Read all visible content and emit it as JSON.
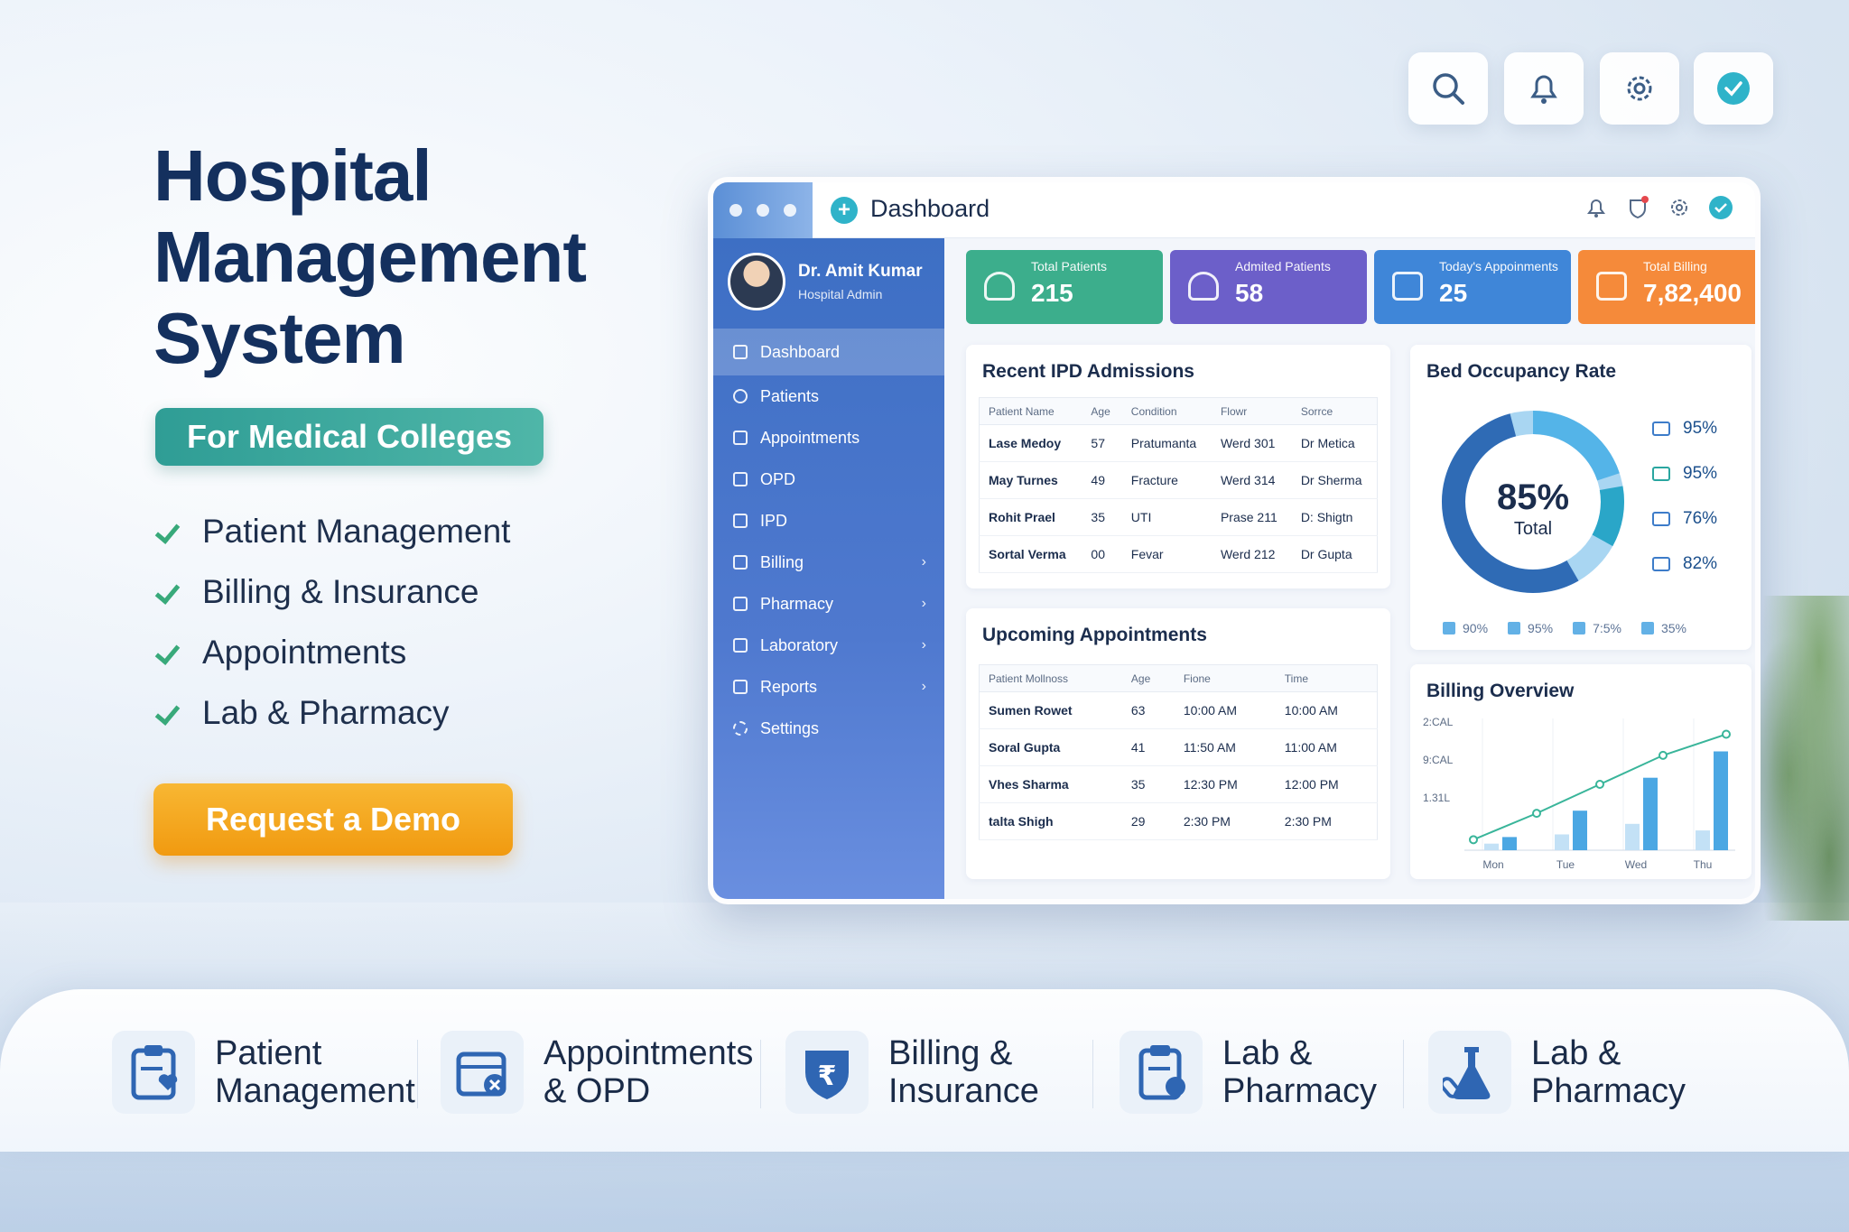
{
  "hero": {
    "title_lines": [
      "Hospital",
      "Management",
      "System"
    ],
    "badge": "For Medical Colleges",
    "features": [
      "Patient Management",
      "Billing & Insurance",
      "Appointments",
      "Lab & Pharmacy"
    ],
    "cta": "Request a Demo"
  },
  "top_icons": [
    "search-icon",
    "bell-icon",
    "gear-icon",
    "check-circle-icon"
  ],
  "window": {
    "title": "Dashboard",
    "header_icons": [
      "bell-icon",
      "shield-icon",
      "gear-icon",
      "check-circle-icon"
    ]
  },
  "sidebar": {
    "user_name": "Dr. Amit Kumar",
    "user_role": "Hospital Admin",
    "items": [
      {
        "label": "Dashboard",
        "icon": "dashboard-icon",
        "active": true
      },
      {
        "label": "Patients",
        "icon": "user-icon"
      },
      {
        "label": "Appointments",
        "icon": "calendar-icon"
      },
      {
        "label": "OPD",
        "icon": "opd-icon"
      },
      {
        "label": "IPD",
        "icon": "bed-icon"
      },
      {
        "label": "Billing",
        "icon": "billing-icon",
        "chevron": true
      },
      {
        "label": "Pharmacy",
        "icon": "pharmacy-icon",
        "chevron": true
      },
      {
        "label": "Laboratory",
        "icon": "lab-icon",
        "chevron": true
      },
      {
        "label": "Reports",
        "icon": "report-icon",
        "chevron": true
      },
      {
        "label": "Settings",
        "icon": "gear-icon"
      }
    ]
  },
  "stats": [
    {
      "label": "Total Patients",
      "value": "215",
      "color": "#3cae8c"
    },
    {
      "label": "Admited Patients",
      "value": "58",
      "color": "#6c5fc9"
    },
    {
      "label": "Today's Appoinments",
      "value": "25",
      "color": "#3f86d8"
    },
    {
      "label": "Total Billing",
      "value": "7,82,400",
      "color": "#f58a3a"
    }
  ],
  "ipd": {
    "title": "Recent IPD Admissions",
    "headers": [
      "Patient Name",
      "Age",
      "Condition",
      "Flowr",
      "Sorrce"
    ],
    "rows": [
      [
        "Lase Medoy",
        "57",
        "Pratumanta",
        "Werd 301",
        "Dr Metica"
      ],
      [
        "May Turnes",
        "49",
        "Fracture",
        "Werd 314",
        "Dr Sherma"
      ],
      [
        "Rohit Prael",
        "35",
        "UTI",
        "Prase 211",
        "D: Shigtn"
      ],
      [
        "Sortal Verma",
        "00",
        "Fevar",
        "Werd 212",
        "Dr Gupta"
      ]
    ]
  },
  "appointments": {
    "title": "Upcoming Appointments",
    "headers": [
      "Patient Mollnoss",
      "Age",
      "Fione",
      "Time"
    ],
    "rows": [
      [
        "Sumen Rowet",
        "63",
        "10:00 AM",
        "10:00 AM"
      ],
      [
        "Soral Gupta",
        "41",
        "11:50 AM",
        "11:00 AM"
      ],
      [
        "Vhes Sharma",
        "35",
        "12:30 PM",
        "12:00 PM"
      ],
      [
        "talta Shigh",
        "29",
        "2:30 PM",
        "2:30 PM"
      ]
    ]
  },
  "bed": {
    "title": "Bed Occupancy Rate",
    "center_value": "85%",
    "center_label": "Total",
    "side_values": [
      "95%",
      "95%",
      "76%",
      "82%"
    ],
    "bottom_values": [
      "90%",
      "95%",
      "7:5%",
      "35%"
    ],
    "colors": [
      "#2f6bb5",
      "#54b4e8",
      "#2aa6c8",
      "#a9d6f2"
    ]
  },
  "billing": {
    "title": "Billing Overview",
    "y_labels": [
      "2:CAL",
      "9:CAL",
      "1.31L"
    ],
    "x_labels": [
      "Mon",
      "Tue",
      "Wed",
      "Thu"
    ]
  },
  "chart_data": {
    "type": "bar",
    "title": "Billing Overview",
    "categories": [
      "Mon",
      "Tue",
      "Wed",
      "Thu"
    ],
    "series": [
      {
        "values": [
          0.1,
          0.3,
          0.55,
          0.75
        ]
      },
      {
        "values": [
          0.05,
          0.12,
          0.2,
          0.15
        ]
      }
    ],
    "line": {
      "values": [
        0.08,
        0.28,
        0.5,
        0.72,
        0.88
      ]
    }
  },
  "feature_bar": [
    {
      "lines": [
        "Patient",
        "Management"
      ],
      "icon": "clipboard-heart-icon"
    },
    {
      "lines": [
        "Appointments",
        "& OPD"
      ],
      "icon": "calendar-x-icon"
    },
    {
      "lines": [
        "Billing &",
        "Insurance"
      ],
      "icon": "rupee-shield-icon"
    },
    {
      "lines": [
        "Lab &",
        "Pharmacy"
      ],
      "icon": "clipboard-pill-icon"
    },
    {
      "lines": [
        "Lab &",
        "Pharmacy"
      ],
      "icon": "flask-icon"
    }
  ]
}
